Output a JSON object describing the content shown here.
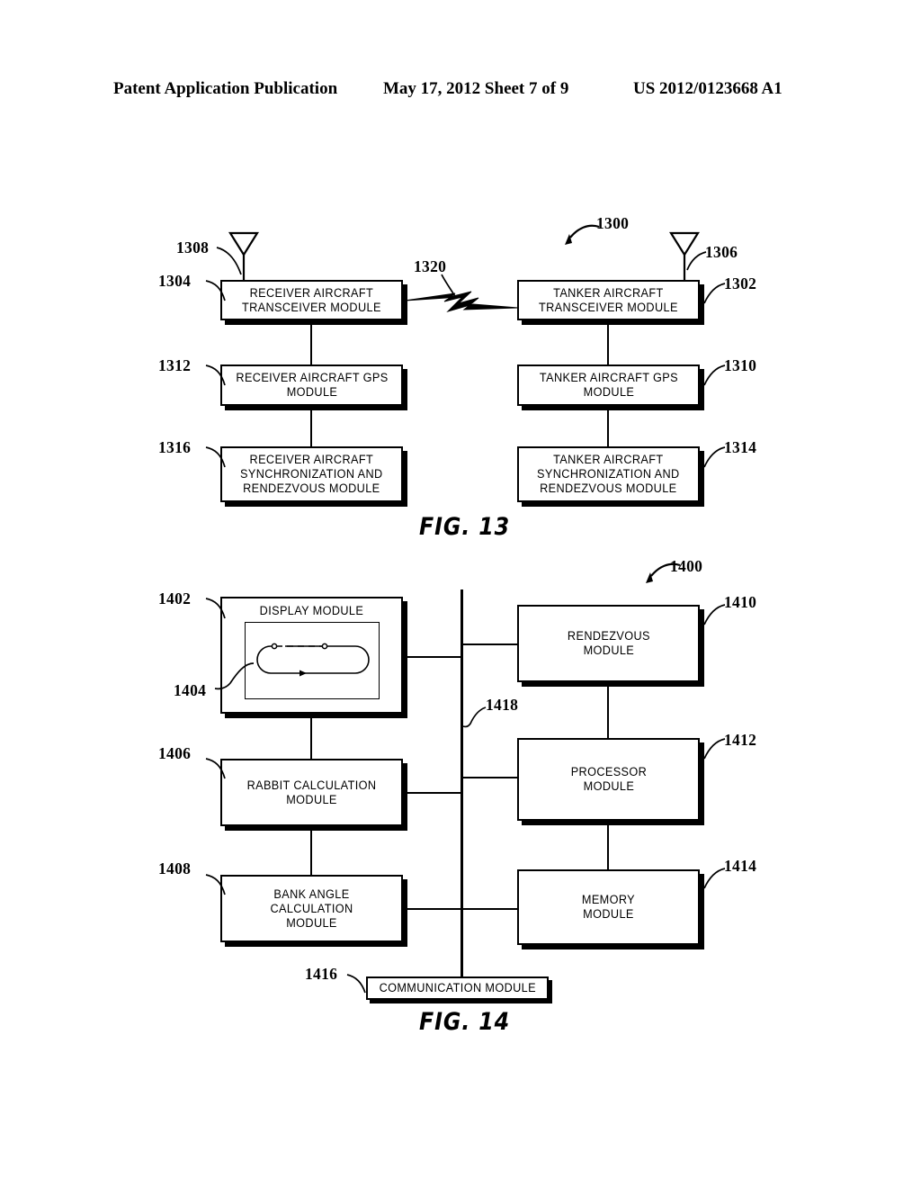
{
  "header": {
    "left": "Patent Application Publication",
    "middle": "May 17, 2012  Sheet 7 of 9",
    "right": "US 2012/0123668 A1"
  },
  "figures": [
    {
      "id": "fig-13",
      "caption": "FIG. 13",
      "system_ref": "1300",
      "boxes": [
        {
          "ref": "1304",
          "label": "RECEIVER AIRCRAFT\nTRANSCEIVER MODULE"
        },
        {
          "ref": "1302",
          "label": "TANKER AIRCRAFT\nTRANSCEIVER MODULE"
        },
        {
          "ref": "1312",
          "label": "RECEIVER AIRCRAFT GPS\nMODULE"
        },
        {
          "ref": "1310",
          "label": "TANKER AIRCRAFT GPS\nMODULE"
        },
        {
          "ref": "1316",
          "label": "RECEIVER AIRCRAFT\nSYNCHRONIZATION AND\nRENDEZVOUS MODULE"
        },
        {
          "ref": "1314",
          "label": "TANKER AIRCRAFT\nSYNCHRONIZATION AND\nRENDEZVOUS MODULE"
        }
      ],
      "antennas": [
        {
          "ref": "1308",
          "side": "left"
        },
        {
          "ref": "1306",
          "side": "right"
        }
      ],
      "wireless_link": {
        "ref": "1320",
        "icon": "lightning-bolt-icon"
      }
    },
    {
      "id": "fig-14",
      "caption": "FIG. 14",
      "system_ref": "1400",
      "boxes": [
        {
          "ref": "1402",
          "label": "DISPLAY MODULE"
        },
        {
          "ref": "1404",
          "label": ""
        },
        {
          "ref": "1406",
          "label": "RABBIT CALCULATION\nMODULE"
        },
        {
          "ref": "1408",
          "label": "BANK ANGLE CALCULATION\nMODULE"
        },
        {
          "ref": "1410",
          "label": "RENDEZVOUS\nMODULE"
        },
        {
          "ref": "1412",
          "label": "PROCESSOR\nMODULE"
        },
        {
          "ref": "1414",
          "label": "MEMORY\nMODULE"
        },
        {
          "ref": "1416",
          "label": "COMMUNICATION MODULE"
        }
      ],
      "bus": {
        "ref": "1418"
      }
    }
  ]
}
